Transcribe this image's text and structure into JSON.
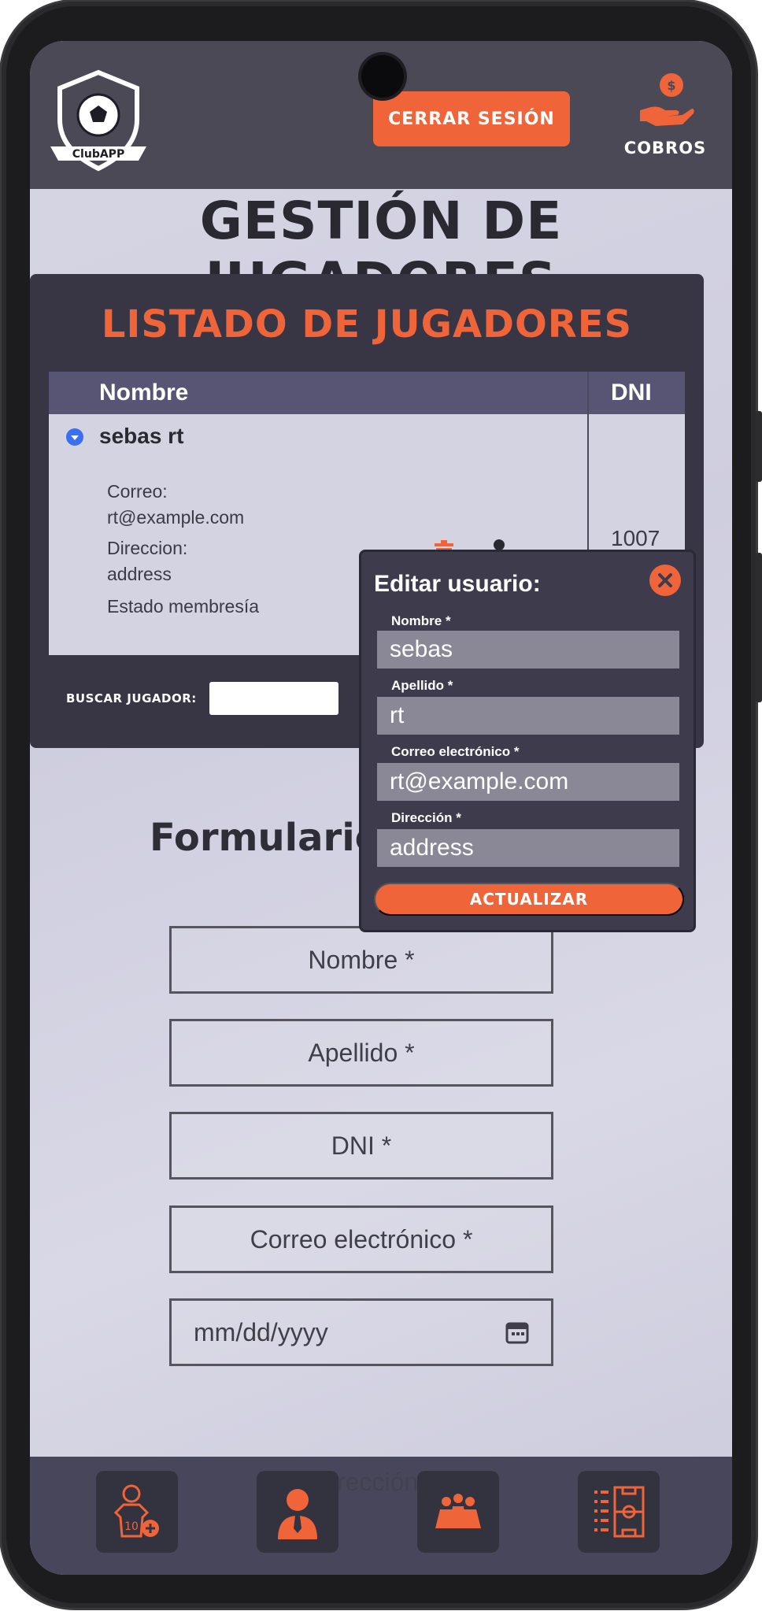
{
  "header": {
    "logo_text": "ClubAPP",
    "logout_label": "Cerrar sesión",
    "cobros_label": "COBROS"
  },
  "page_title": "Gestión de jugadores",
  "players_list": {
    "title": "Listado de jugadores",
    "columns": [
      "Nombre",
      "DNI"
    ],
    "row": {
      "name": "sebas rt",
      "dni": "1007",
      "correo_label": "Correo:",
      "correo_value": "rt@example.com",
      "direccion_label": "Direccion:",
      "direccion_value": "address",
      "estado_label": "Estado membresía"
    },
    "search_label": "Buscar jugador:"
  },
  "edit_modal": {
    "title": "Editar usuario:",
    "fields": [
      {
        "label": "Nombre *",
        "value": "sebas"
      },
      {
        "label": "Apellido *",
        "value": "rt"
      },
      {
        "label": "Correo electrónico *",
        "value": "rt@example.com"
      },
      {
        "label": "Dirección *",
        "value": "address"
      }
    ],
    "update_label": "Actualizar"
  },
  "register_form": {
    "title_visible": "Formulario d",
    "fields": [
      "Nombre *",
      "Apellido *",
      "DNI *",
      "Correo electrónico *",
      "mm/dd/yyyy",
      "rección"
    ]
  },
  "bottom_nav": [
    "add-player",
    "coach",
    "team",
    "field"
  ],
  "colors": {
    "accent": "#f0643a",
    "header_bg": "#4a4955",
    "panel_bg": "#383644"
  }
}
